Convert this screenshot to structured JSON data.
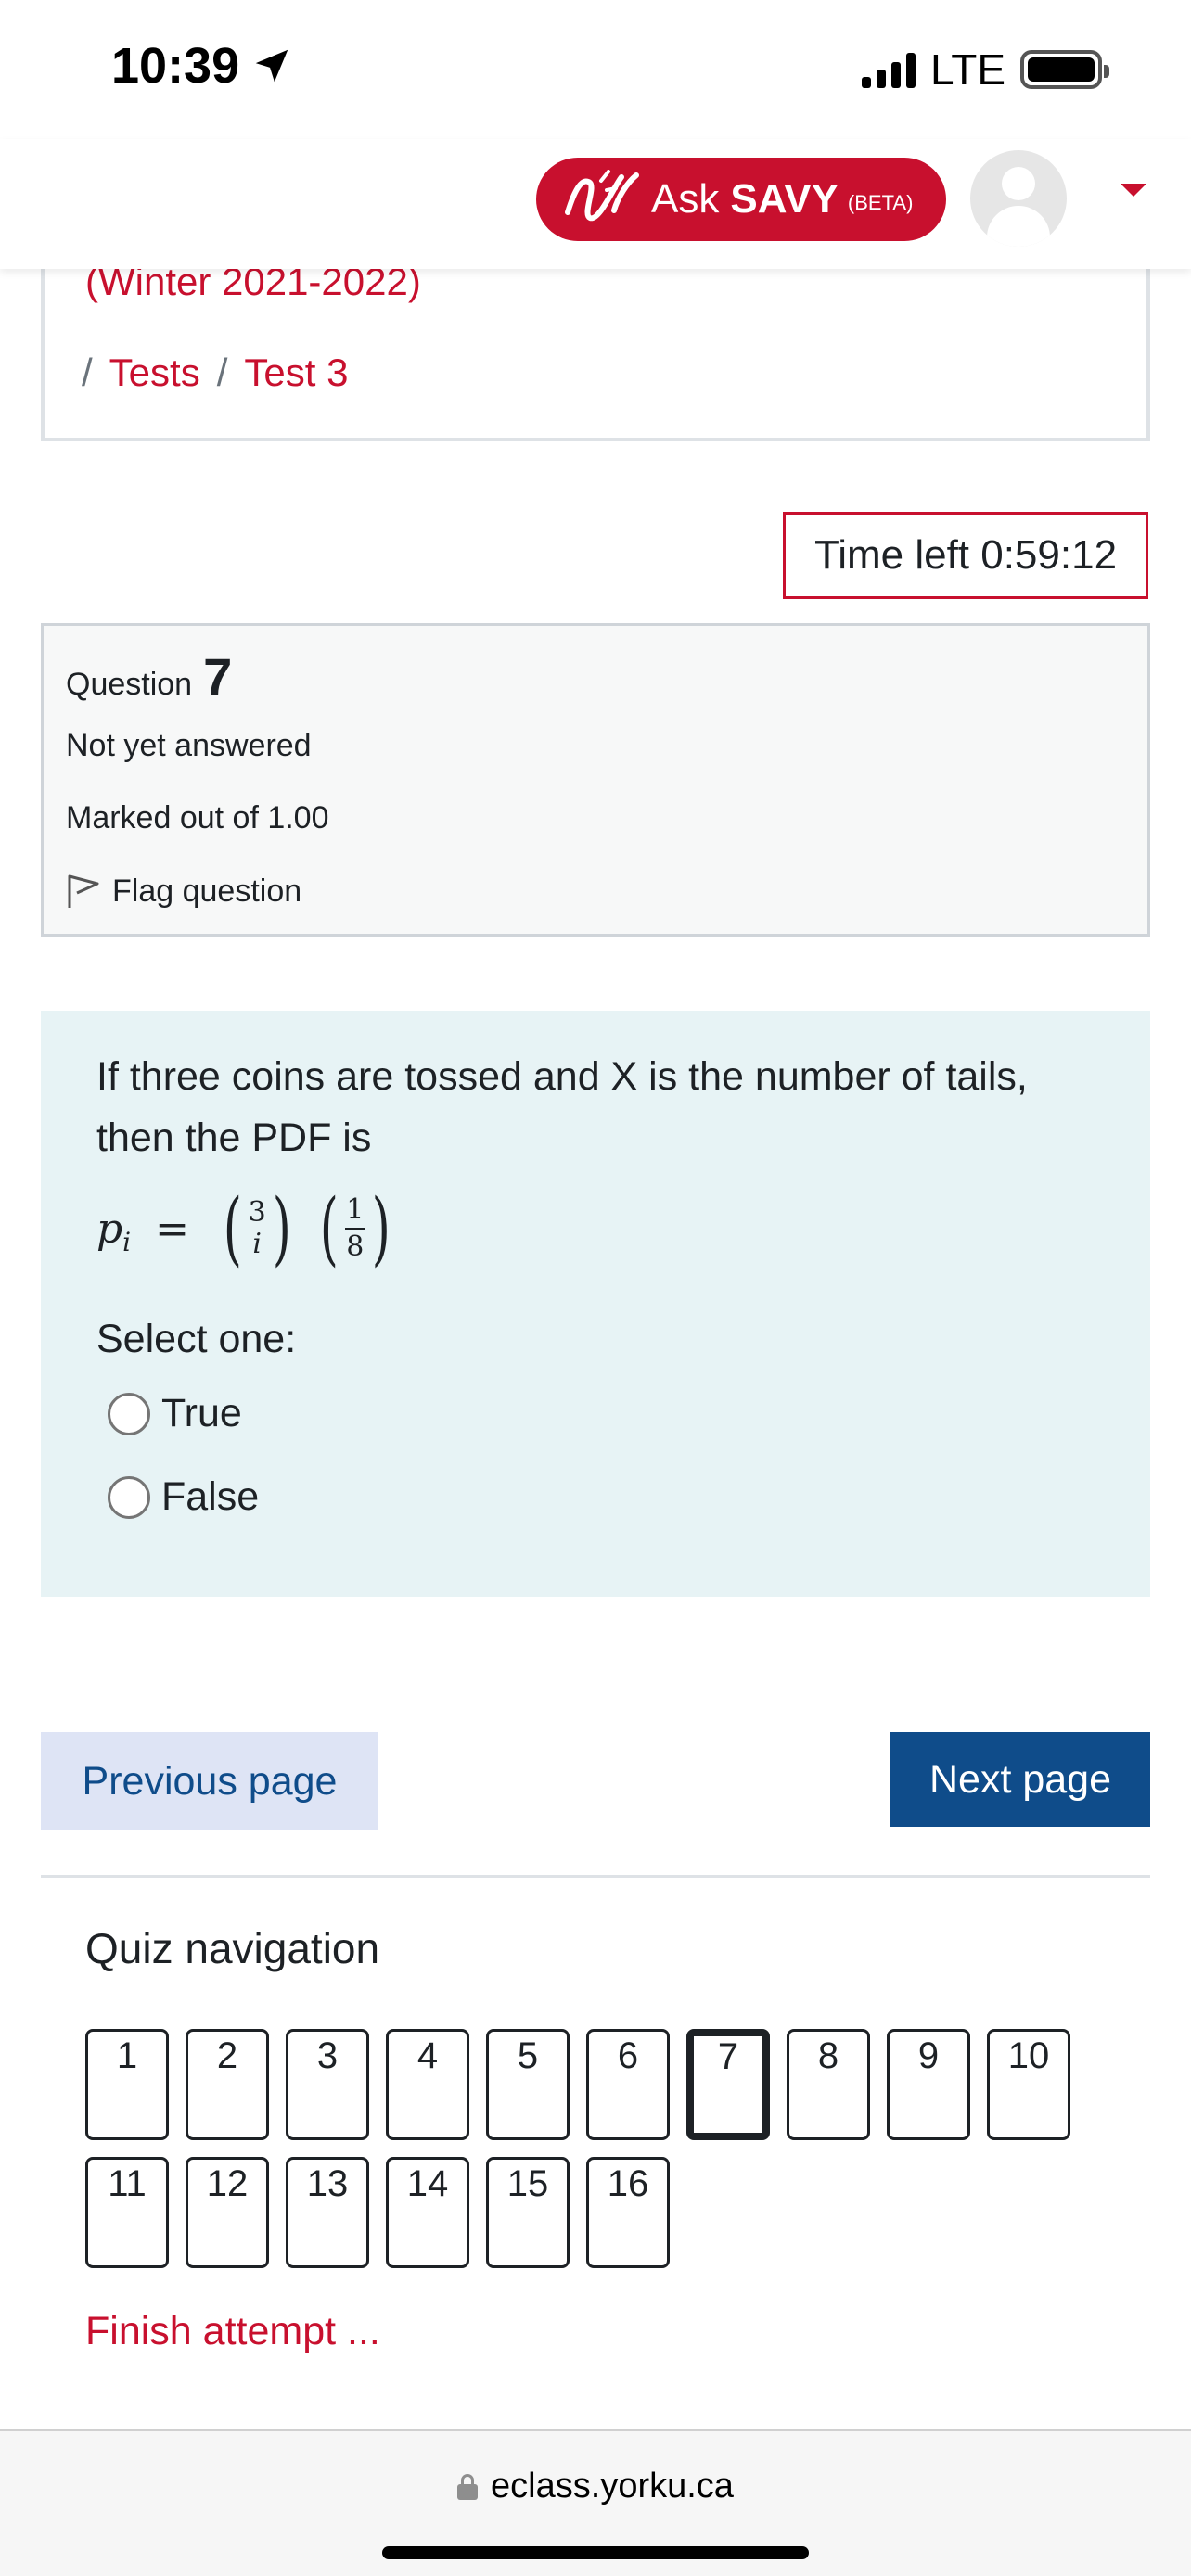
{
  "status_bar": {
    "time": "10:39",
    "network": "LTE"
  },
  "header": {
    "ask_label": "Ask",
    "savy_label": "SAVY",
    "beta_label": "(BETA)",
    "brand_color": "#c8102e"
  },
  "breadcrumb": {
    "course": "(Winter 2021-2022)",
    "sep1": "/",
    "item1": "Tests",
    "sep2": "/",
    "item2": "Test 3"
  },
  "timer": {
    "text": "Time left 0:59:12"
  },
  "question_info": {
    "label": "Question",
    "number": "7",
    "state": "Not yet answered",
    "grade": "Marked out of 1.00",
    "flag_label": "Flag question"
  },
  "question": {
    "text": "If three coins are tossed and X is the number of tails, then the PDF is",
    "formula": {
      "lhs_var": "p",
      "lhs_sub": "i",
      "equals": "=",
      "binom_top": "3",
      "binom_bottom": "i",
      "frac_num": "1",
      "frac_den": "8",
      "open_paren": "(",
      "close_paren": ")"
    },
    "prompt": "Select one:",
    "options": [
      {
        "label": "True",
        "selected": false
      },
      {
        "label": "False",
        "selected": false
      }
    ]
  },
  "buttons": {
    "previous": "Previous page",
    "next": "Next page"
  },
  "quiz_nav": {
    "title": "Quiz navigation",
    "current": 7,
    "questions": [
      "1",
      "2",
      "3",
      "4",
      "5",
      "6",
      "7",
      "8",
      "9",
      "10",
      "11",
      "12",
      "13",
      "14",
      "15",
      "16"
    ],
    "finish": "Finish attempt ..."
  },
  "browser": {
    "url": "eclass.yorku.ca"
  }
}
